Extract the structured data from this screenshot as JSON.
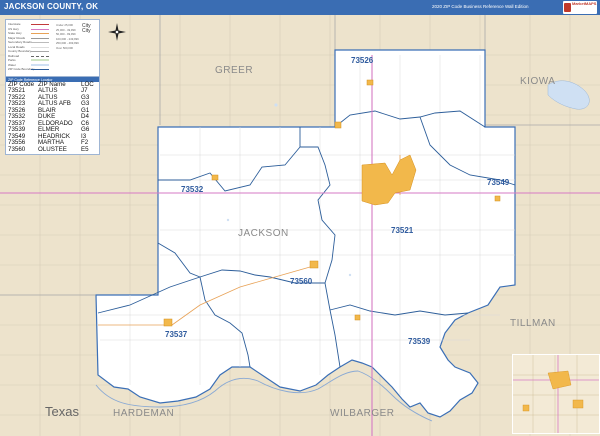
{
  "header": {
    "title": "JACKSON COUNTY, OK",
    "edition": "2020 ZIP Code Business Reference Wall Edition",
    "logo_text": "MarketMAPS"
  },
  "map": {
    "county_labels": [
      "GREER",
      "KIOWA",
      "TILLMAN",
      "WILBARGER",
      "HARDEMAN"
    ],
    "state_label": "Texas",
    "county_focus": "JACKSON",
    "zip_labels": [
      "73526",
      "73549",
      "73532",
      "73521",
      "73560",
      "73537",
      "73539"
    ],
    "colors": {
      "background": "#ede3cc",
      "county_fill": "#ffffff",
      "water": "#d2e2f2",
      "zip_boundary": "#2d5e9a",
      "highway": "#d67ac4",
      "city": "#f2b84b",
      "header": "#3a6db3"
    }
  },
  "legend": {
    "rows": [
      "Interstate",
      "US Hwy",
      "State Hwy",
      "Major Roads",
      "Secondary Roads",
      "Local Roads",
      "County Boundary",
      "Railroad",
      "Parks",
      "Water",
      "ZIP Code Boundary"
    ],
    "right_rows": [
      "Under 25,000",
      "25,000 - 49,999",
      "50,000 - 99,999",
      "100,000 - 249,999",
      "250,000 - 499,999",
      "Over 500,000"
    ],
    "city_title": "City",
    "city_sub": "City"
  },
  "zip_table": {
    "title": "ZIP Code Reference Locator",
    "columns": [
      "ZIP Code",
      "ZIP Name",
      "LOC"
    ],
    "rows": [
      {
        "zip": "73521",
        "name": "ALTUS",
        "loc": "J7"
      },
      {
        "zip": "73522",
        "name": "ALTUS",
        "loc": "G3"
      },
      {
        "zip": "73523",
        "name": "ALTUS AFB",
        "loc": "G3"
      },
      {
        "zip": "73526",
        "name": "BLAIR",
        "loc": "G1"
      },
      {
        "zip": "73532",
        "name": "DUKE",
        "loc": "D4"
      },
      {
        "zip": "73537",
        "name": "ELDORADO",
        "loc": "C6"
      },
      {
        "zip": "73539",
        "name": "ELMER",
        "loc": "G6"
      },
      {
        "zip": "73549",
        "name": "HEADRICK",
        "loc": "I3"
      },
      {
        "zip": "73556",
        "name": "MARTHA",
        "loc": "F2"
      },
      {
        "zip": "73560",
        "name": "OLUSTEE",
        "loc": "E5"
      }
    ]
  },
  "inset": {
    "icon": "locator-inset-map"
  },
  "compass": {
    "icon": "compass-rose-icon"
  }
}
